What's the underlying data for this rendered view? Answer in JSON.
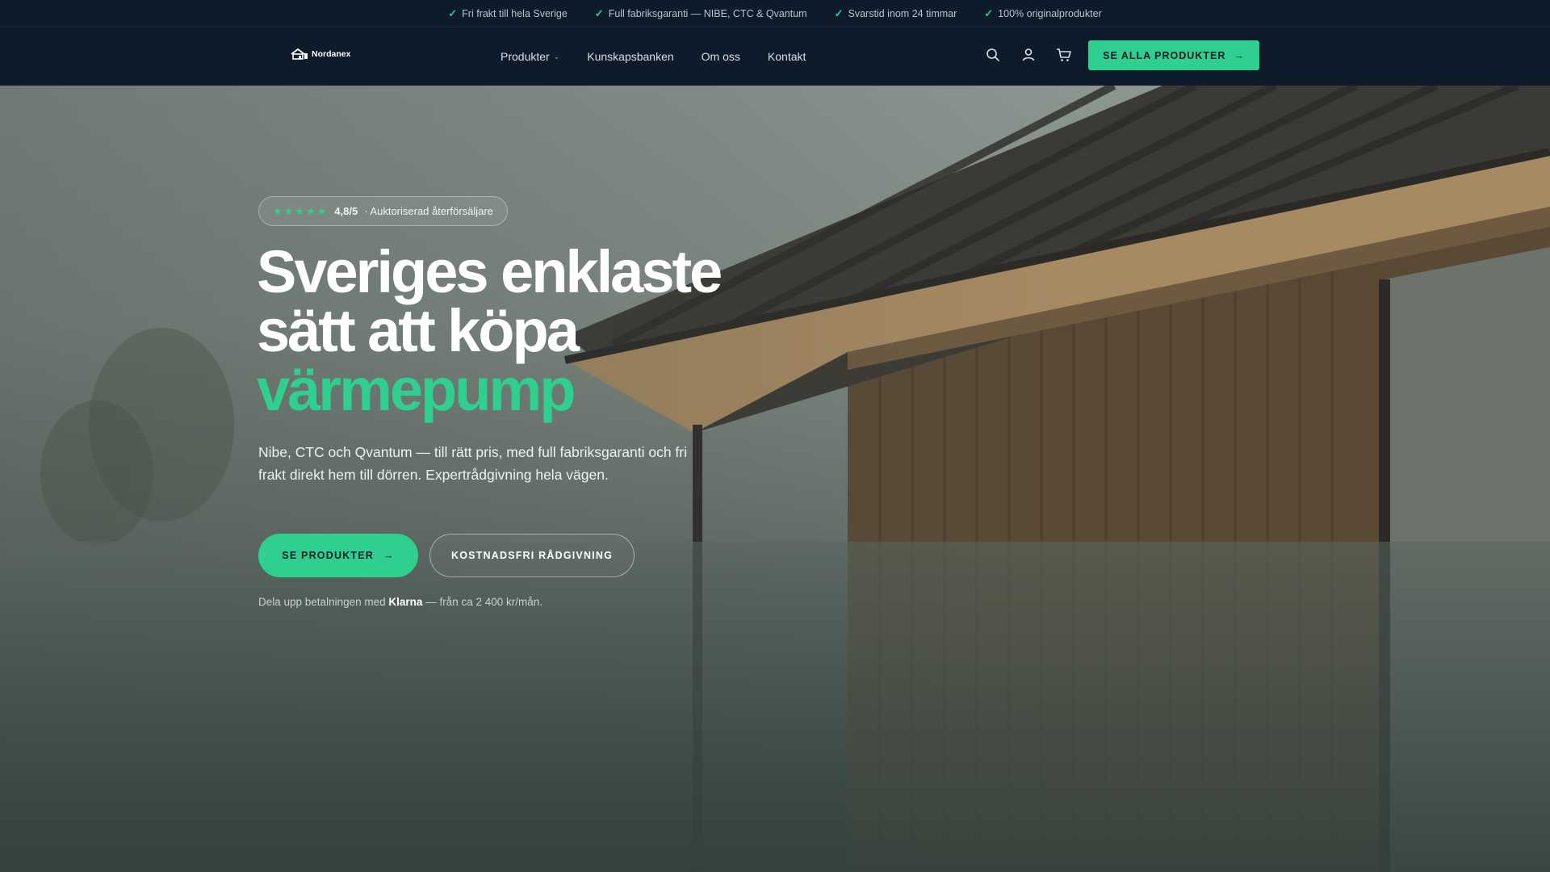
{
  "topbar": {
    "items": [
      "Fri frakt till hela Sverige",
      "Full fabriksgaranti — NIBE, CTC & Qvantum",
      "Svarstid inom 24 timmar",
      "100% originalprodukter"
    ]
  },
  "nav": {
    "logo_text": "Nordanex",
    "menu": [
      {
        "label": "Produkter",
        "has_dropdown": true
      },
      {
        "label": "Kunskapsbanken"
      },
      {
        "label": "Om oss"
      },
      {
        "label": "Kontakt"
      }
    ],
    "icons": [
      "search-icon",
      "user-icon",
      "cart-icon"
    ],
    "cta_label": "SE ALLA PRODUKTER"
  },
  "hero": {
    "rating_badge": {
      "stars": "★★★★★",
      "rating": "4,8/5",
      "text": "· Auktoriserad återförsäljare"
    },
    "headline_line1": "Sveriges enklaste",
    "headline_line2": "sätt att köpa",
    "headline_accent": "värmepump",
    "lead": "Nibe, CTC och Qvantum — till rätt pris, med full fabriksgaranti och fri frakt direkt hem till dörren. Expertrådgivning hela vägen.",
    "primary_button": "SE PRODUKTER",
    "secondary_button": "KOSTNADSFRI RÅDGIVNING",
    "klarna": {
      "prefix": "Dela upp betalningen med",
      "brand": "Klarna",
      "suffix": "— från ca 2 400 kr/mån."
    }
  },
  "colors": {
    "accent": "#2fd08f",
    "navbar": "#0d1b2a"
  }
}
